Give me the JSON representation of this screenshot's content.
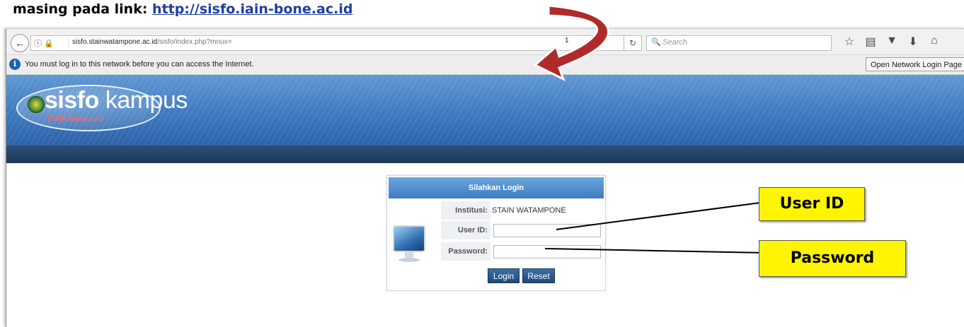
{
  "doc": {
    "prefix": "masing pada link: ",
    "link": "http://sisfo.iain-bone.ac.id"
  },
  "browser": {
    "url_host": "sisfo.stainwatampone.ac.id",
    "url_path": "/sisfo/index.php?mnux=",
    "url_marker": "1",
    "search_placeholder": "Search",
    "notification": "You must log in to this network before you can access the Internet.",
    "open_login_button": "Open Network Login Page",
    "toolbar_icons": [
      "star-icon",
      "reading-list-icon",
      "pocket-icon",
      "download-icon",
      "home-icon"
    ]
  },
  "site": {
    "logo_word": "sisfo",
    "logo_word2": "kampus",
    "logo_sub": "STAIN Watampone"
  },
  "login": {
    "title": "Silahkan Login",
    "institusi_label": "Institusi:",
    "institusi_value": "STAIN WATAMPONE",
    "userid_label": "User ID:",
    "password_label": "Password:",
    "login_button": "Login",
    "reset_button": "Reset"
  },
  "annotations": {
    "userid": "User ID",
    "password": "Password"
  },
  "colors": {
    "header_blue": "#3d79bf",
    "nav_dark": "#1c3556",
    "callout_yellow": "#fff500",
    "arrow_red": "#b02a2a"
  }
}
